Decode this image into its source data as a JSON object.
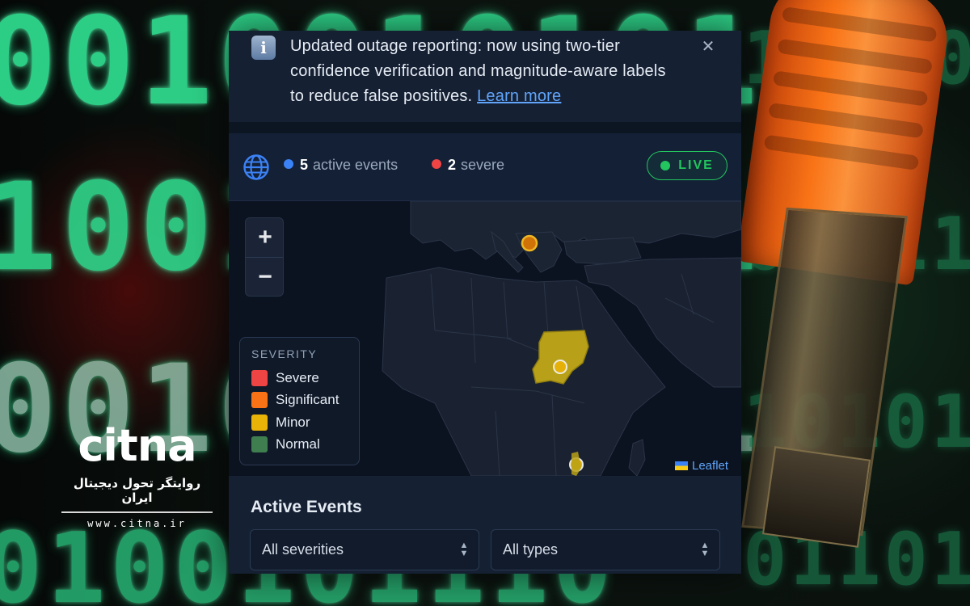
{
  "background": {
    "binary_rows": [
      "0010010101",
      "1001001101",
      "0010101011",
      "0100101110"
    ],
    "binary_right": [
      "10110",
      "01011",
      "10101",
      "01101"
    ],
    "logo": {
      "word_part1": "cit",
      "word_part2": "na",
      "tagline": "روایتگر تحول دیجیتال ایران",
      "url": "www.citna.ir"
    }
  },
  "banner": {
    "icon": "info-icon",
    "text": "Updated outage reporting: now using two-tier confidence verification and magnitude-aware labels to reduce false positives.",
    "link_label": "Learn more",
    "close_icon": "close-icon"
  },
  "status": {
    "active_count": "5",
    "active_label": "active events",
    "active_color": "#3b82f6",
    "severe_count": "2",
    "severe_label": "severe",
    "severe_color": "#ef4444",
    "live_label": "LIVE",
    "live_color": "#22c55e"
  },
  "map": {
    "zoom_in": "+",
    "zoom_out": "−",
    "legend": {
      "title": "SEVERITY",
      "items": [
        {
          "label": "Severe",
          "color": "#ef4444"
        },
        {
          "label": "Significant",
          "color": "#f97316"
        },
        {
          "label": "Minor",
          "color": "#eab308"
        },
        {
          "label": "Normal",
          "color": "#3f7f4f"
        }
      ]
    },
    "attribution": "Leaflet",
    "highlighted_region": {
      "name": "Sudan",
      "severity": "Minor",
      "color": "#b8a118"
    },
    "markers": [
      {
        "region": "Balkans",
        "severity": "Significant",
        "color": "#d97706"
      },
      {
        "region": "Sudan",
        "severity": "Minor",
        "color": "#eab308"
      },
      {
        "region": "Malawi",
        "severity": "Minor",
        "color": "#eab308"
      }
    ]
  },
  "events": {
    "title": "Active Events",
    "severity_filter": "All severities",
    "type_filter": "All types"
  }
}
